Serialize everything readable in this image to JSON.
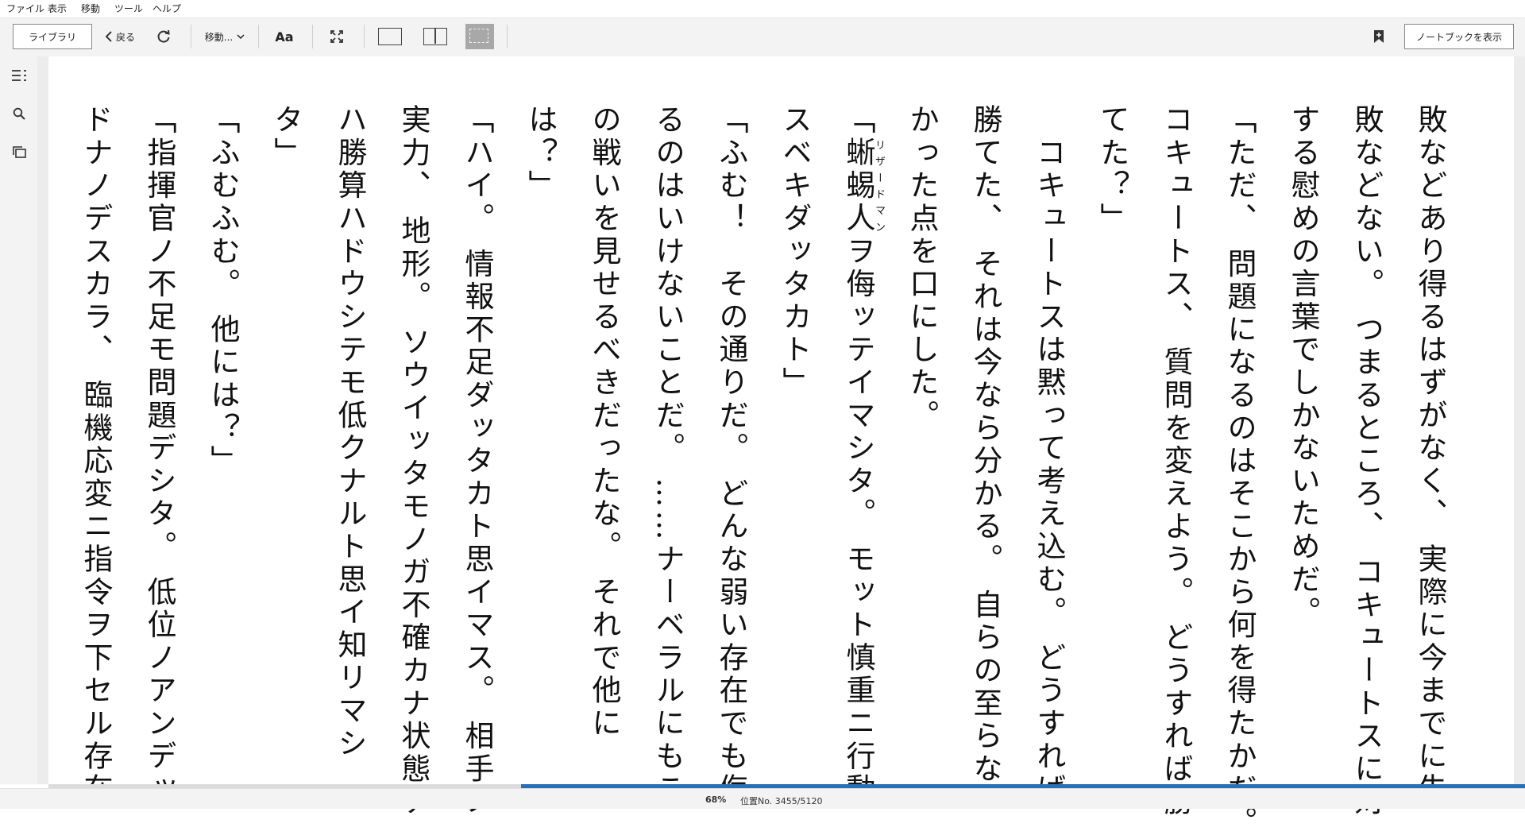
{
  "menu": [
    "ファイル",
    "表示",
    "移動",
    "ツール",
    "ヘルプ"
  ],
  "toolbar": {
    "library_label": "ライブラリ",
    "back_label": "戻る",
    "goto_label": "移動...",
    "font_label": "Aa",
    "notebook_label": "ノートブックを表示"
  },
  "reader": {
    "ruby_text": "リザードマン",
    "paragraphs": [
      "敗などあり得るはずがなく、 実際に今までに失",
      "敗などない。 つまるところ、 コキュートスに対",
      "する慰めの言葉でしかないためだ。",
      "「ただ、 問題になるのはそこから何を得たかだ。",
      "コキュートス、 質問を変えよう。 どうすれば勝",
      "てた？」",
      "　コキュートスは黙って考え込む。 どうすれば",
      "勝てた、 それは今なら分かる。 自らの至らな",
      "かった点を口にした。",
      "「蜥蜴人ヲ侮ッテイマシタ。 モット慎重ニ行動",
      "スベキダッタカト」",
      "「ふむ！　その通りだ。 どんな弱い存在でも侮",
      "るのはいけないことだ。 ……ナーベラルにもこ",
      "の戦いを見せるべきだったな。 それで他に",
      "は？」",
      "「ハイ。 情報不足ダッタカト思イマス。 相手ノ",
      "実力、 地形。 ソウイッタモノガ不確カナ状態デ",
      "ハ勝算ハドウシテモ低クナルト思イ知リマシ",
      "タ」",
      "「ふむふむ。 他には？」",
      "「指揮官ノ不足モ問題デシタ。 低位ノアンデッ",
      "ドナノデスカラ、 臨機応変ニ指令ヲ下セル存在"
    ]
  },
  "status": {
    "percent_label": "68%",
    "location_label": "位置No. 3455/5120",
    "progress_fraction": 0.68
  },
  "colors": {
    "progress": "#2a6fb5",
    "toolbar_bg": "#f3f3f3"
  },
  "icons": [
    "back-chevron-icon",
    "refresh-icon",
    "chevron-down-icon",
    "fullscreen-icon",
    "single-page-icon",
    "two-page-icon",
    "fit-page-icon",
    "bookmark-add-icon",
    "toc-icon",
    "search-icon",
    "flashcards-icon"
  ]
}
